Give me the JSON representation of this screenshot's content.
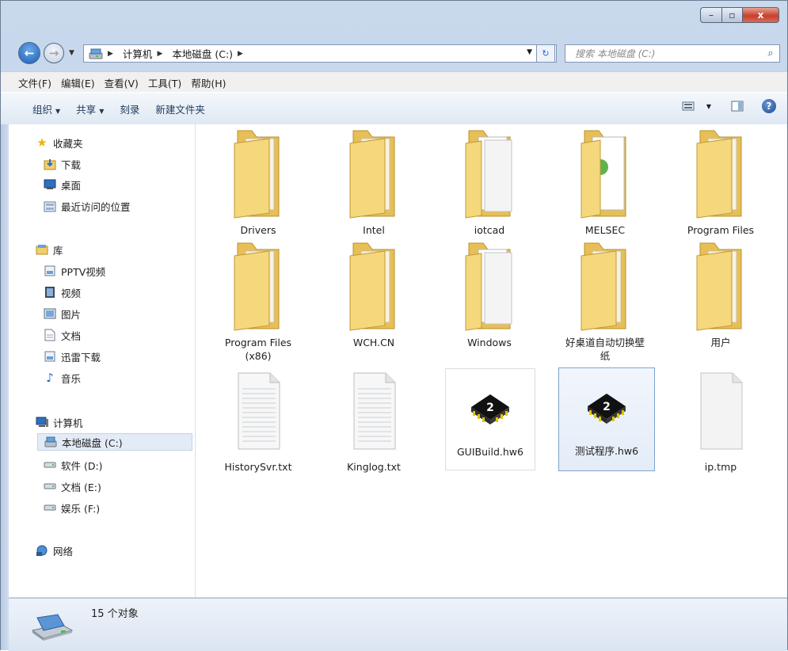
{
  "window": {
    "controls": {
      "minimize": "–",
      "maximize": "▫",
      "close": "x"
    }
  },
  "nav": {
    "back": "←",
    "forward": "→",
    "address": {
      "crumbs": [
        "计算机",
        "本地磁盘 (C:)"
      ]
    },
    "search_placeholder": "搜索 本地磁盘 (C:)"
  },
  "menu": [
    "文件(F)",
    "编辑(E)",
    "查看(V)",
    "工具(T)",
    "帮助(H)"
  ],
  "toolbar": {
    "organize": "组织",
    "share": "共享",
    "burn": "刻录",
    "new_folder": "新建文件夹",
    "help": "?"
  },
  "sidebar": {
    "favorites": {
      "label": "收藏夹",
      "items": [
        "下载",
        "桌面",
        "最近访问的位置"
      ]
    },
    "libraries": {
      "label": "库",
      "items": [
        "PPTV视频",
        "视频",
        "图片",
        "文档",
        "迅雷下载",
        "音乐"
      ]
    },
    "computer": {
      "label": "计算机",
      "items": [
        "本地磁盘 (C:)",
        "软件 (D:)",
        "文档 (E:)",
        "娱乐 (F:)"
      ],
      "selected": "本地磁盘 (C:)"
    },
    "network": {
      "label": "网络"
    }
  },
  "files": [
    {
      "name": "Drivers",
      "type": "folder"
    },
    {
      "name": "Intel",
      "type": "folder"
    },
    {
      "name": "iotcad",
      "type": "folder-open"
    },
    {
      "name": "MELSEC",
      "type": "folder-green"
    },
    {
      "name": "Program Files",
      "type": "folder"
    },
    {
      "name": "Program Files (x86)",
      "type": "folder"
    },
    {
      "name": "WCH.CN",
      "type": "folder"
    },
    {
      "name": "Windows",
      "type": "folder-open"
    },
    {
      "name": "好桌道自动切换壁纸",
      "type": "folder"
    },
    {
      "name": "用户",
      "type": "folder"
    },
    {
      "name": "HistorySvr.txt",
      "type": "text"
    },
    {
      "name": "Kinglog.txt",
      "type": "text"
    },
    {
      "name": "GUIBuild.hw6",
      "type": "chip"
    },
    {
      "name": "测试程序.hw6",
      "type": "chip",
      "selected": true
    },
    {
      "name": "ip.tmp",
      "type": "blank"
    }
  ],
  "status": {
    "count": "15 个对象"
  },
  "colors": {
    "folder": "#f2cf6a",
    "selection": "#e3ebf6",
    "accent": "#1e5db3"
  }
}
